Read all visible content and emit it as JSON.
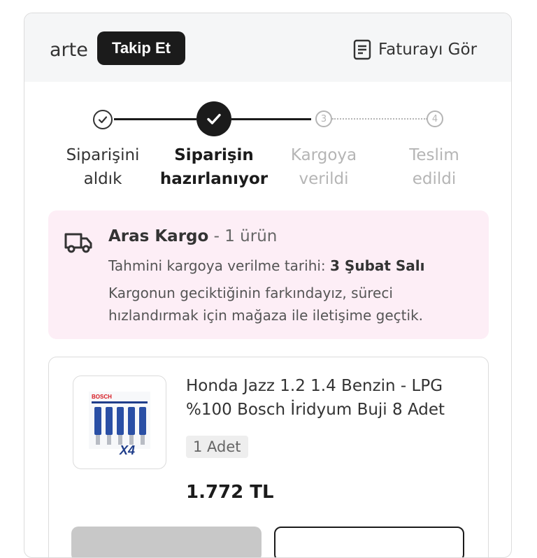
{
  "header": {
    "seller_name": "arte",
    "follow_label": "Takip Et",
    "invoice_label": "Faturayı Gör"
  },
  "tracker": {
    "steps": [
      {
        "label_line1": "Siparişini",
        "label_line2": "aldık",
        "status": "done"
      },
      {
        "label_line1": "Siparişin",
        "label_line2": "hazırlanıyor",
        "status": "active"
      },
      {
        "label_line1": "Kargoya",
        "label_line2": "verildi",
        "status": "pending",
        "number": "3"
      },
      {
        "label_line1": "Teslim",
        "label_line2": "edildi",
        "status": "pending",
        "number": "4"
      }
    ]
  },
  "shipment": {
    "carrier": "Aras Kargo",
    "item_count": "- 1 ürün",
    "eta_label": "Tahmini kargoya verilme tarihi:",
    "eta_value": "3 Şubat Salı",
    "delay_message": "Kargonun geciktiğinin farkındayız, süreci hızlandırmak için mağaza ile iletişime geçtik."
  },
  "product": {
    "title": "Honda Jazz 1.2 1.4 Benzin - LPG %100 Bosch İridyum Buji 8 Adet",
    "quantity": "1 Adet",
    "price": "1.772 TL",
    "image_brand": "BOSCH",
    "image_badge": "X4"
  },
  "colors": {
    "accent": "#1b1b1b",
    "pending": "#b5b5b5",
    "info_bg": "#fdeef6",
    "header_bg": "#f5f6f7"
  }
}
